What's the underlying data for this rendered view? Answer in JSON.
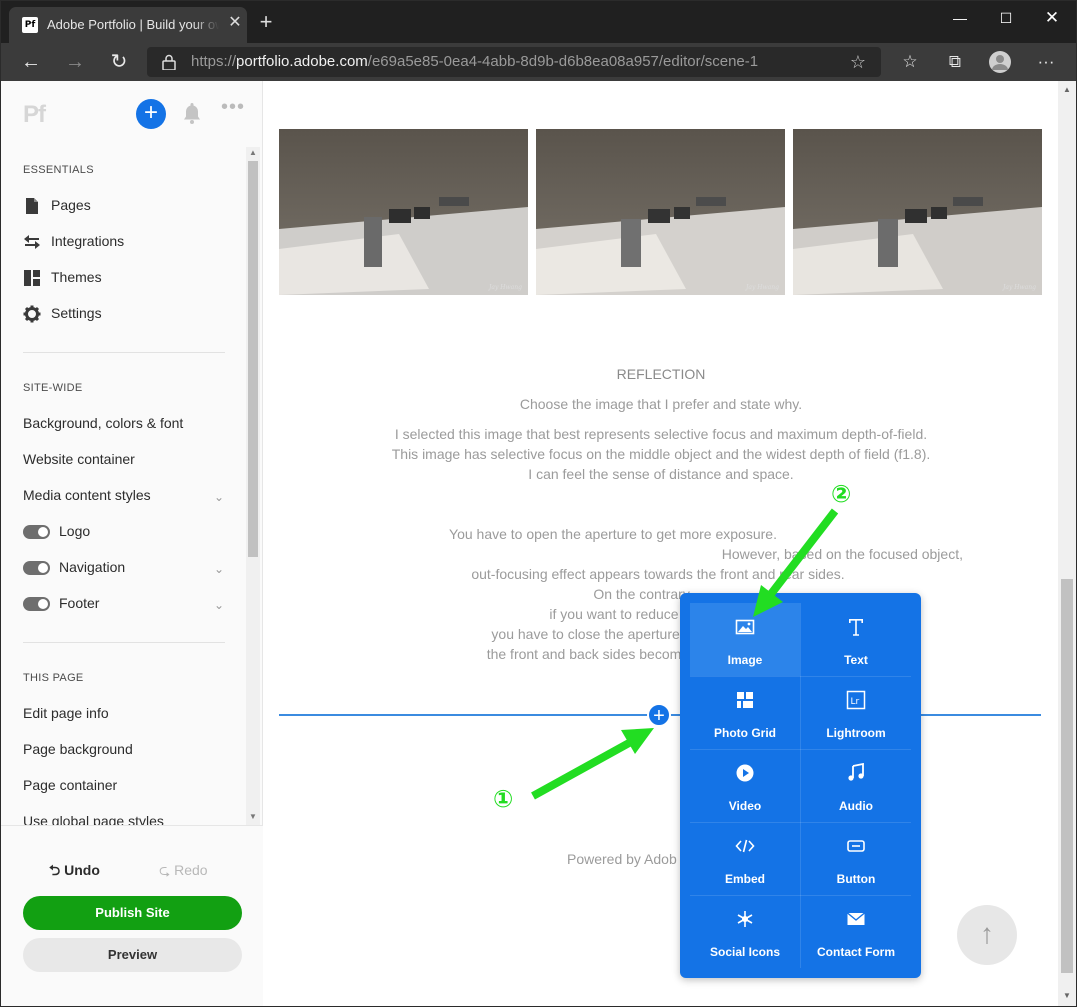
{
  "browser": {
    "tab_title": "Adobe Portfolio | Build your own",
    "tab_favicon": "Pf",
    "url_scheme": "https://",
    "url_host": "portfolio.adobe.com",
    "url_path": "/e69a5e85-0ea4-4abb-8d9b-d6b8ea08a957/editor/scene-1"
  },
  "sidebar": {
    "logo": "Pf",
    "essentials_heading": "ESSENTIALS",
    "essentials": [
      {
        "label": "Pages",
        "icon": "page-icon"
      },
      {
        "label": "Integrations",
        "icon": "integrations-icon"
      },
      {
        "label": "Themes",
        "icon": "themes-icon"
      },
      {
        "label": "Settings",
        "icon": "gear-icon"
      }
    ],
    "sitewide_heading": "SITE-WIDE",
    "sitewide": [
      {
        "label": "Background, colors & font"
      },
      {
        "label": "Website container"
      },
      {
        "label": "Media content styles"
      },
      {
        "label": "Logo"
      },
      {
        "label": "Navigation"
      },
      {
        "label": "Footer"
      }
    ],
    "thispage_heading": "THIS PAGE",
    "thispage": [
      {
        "label": "Edit page info"
      },
      {
        "label": "Page background"
      },
      {
        "label": "Page container"
      },
      {
        "label": "Use global page styles"
      }
    ],
    "undo": "Undo",
    "redo": "Redo",
    "publish": "Publish Site",
    "preview": "Preview"
  },
  "main": {
    "photo_watermark": "Jay Hwang",
    "reflection_title": "REFLECTION",
    "reflection_lines": [
      "Choose the image that I prefer and state why.",
      "I selected this image that best represents selective focus and maximum depth-of-field.",
      "This image has selective focus on the middle object and the widest depth of field (f1.8).",
      "I can feel the sense of distance and space.",
      "You have to open the aperture to get more expos",
      "However, based on the focused object,",
      "out-focusing effect appears towards the front an",
      "On the contrary,",
      "if you want to reduce",
      "you have to close the aperture, but th",
      "the front and back sides become clear"
    ],
    "reflection_tails": [
      "ure.",
      "",
      "d rear sides.",
      "",
      "",
      "",
      ""
    ],
    "powered": "Powered by Adob"
  },
  "insert_menu": {
    "items": [
      {
        "label": "Image",
        "icon": "image-icon"
      },
      {
        "label": "Text",
        "icon": "text-icon"
      },
      {
        "label": "Photo Grid",
        "icon": "photo-grid-icon"
      },
      {
        "label": "Lightroom",
        "icon": "lightroom-icon"
      },
      {
        "label": "Video",
        "icon": "video-icon"
      },
      {
        "label": "Audio",
        "icon": "audio-icon"
      },
      {
        "label": "Embed",
        "icon": "embed-icon"
      },
      {
        "label": "Button",
        "icon": "button-icon"
      },
      {
        "label": "Social Icons",
        "icon": "social-icons-icon"
      },
      {
        "label": "Contact Form",
        "icon": "contact-form-icon"
      }
    ]
  },
  "annotations": {
    "step1": "①",
    "step2": "②"
  },
  "colors": {
    "accent_blue": "#1473e6",
    "publish_green": "#12a012",
    "annotation_green": "#22dd22"
  }
}
